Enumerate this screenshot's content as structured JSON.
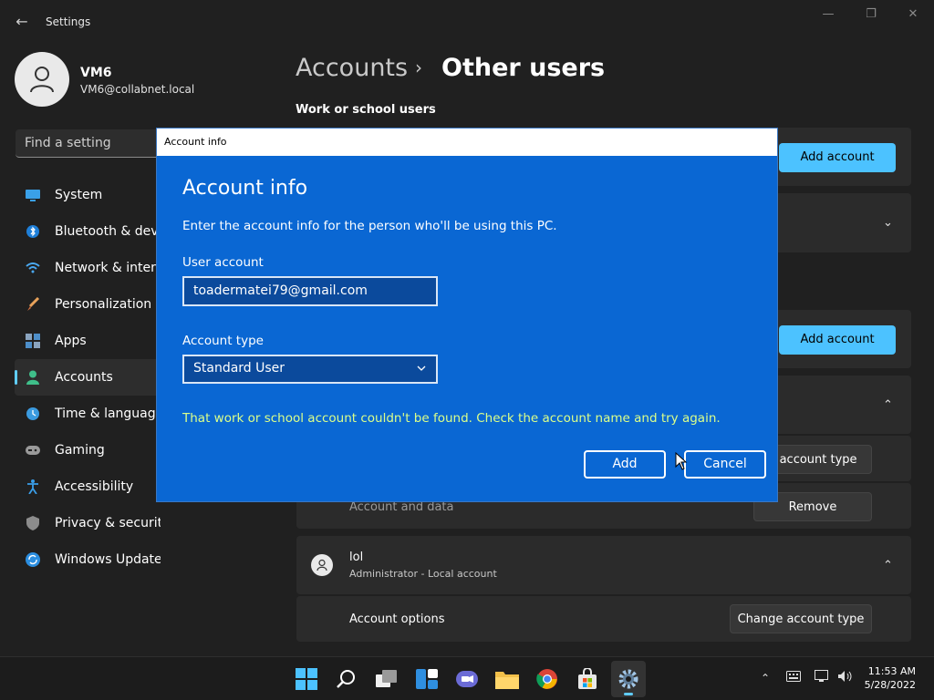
{
  "app": {
    "title": "Settings",
    "back_glyph": "←",
    "window_controls": {
      "minimize": "—",
      "maximize": "❐",
      "close": "✕"
    }
  },
  "profile": {
    "name": "VM6",
    "email": "VM6@collabnet.local"
  },
  "search": {
    "placeholder": "Find a setting"
  },
  "nav": {
    "items": [
      {
        "label": "System",
        "icon": "monitor-icon"
      },
      {
        "label": "Bluetooth & devices",
        "icon": "bluetooth-icon"
      },
      {
        "label": "Network & internet",
        "icon": "wifi-icon"
      },
      {
        "label": "Personalization",
        "icon": "brush-icon"
      },
      {
        "label": "Apps",
        "icon": "apps-icon"
      },
      {
        "label": "Accounts",
        "icon": "person-icon",
        "active": true
      },
      {
        "label": "Time & language",
        "icon": "globe-clock-icon"
      },
      {
        "label": "Gaming",
        "icon": "gamepad-icon"
      },
      {
        "label": "Accessibility",
        "icon": "accessibility-icon"
      },
      {
        "label": "Privacy & security",
        "icon": "shield-icon"
      },
      {
        "label": "Windows Update",
        "icon": "update-icon"
      }
    ]
  },
  "main": {
    "breadcrumb_parent": "Accounts",
    "breadcrumb_sep": "›",
    "breadcrumb_current": "Other users",
    "section_work": "Work or school users",
    "add_account_1": "Add account",
    "add_account_2": "Add account",
    "change_account_type_partial": "e account type",
    "account_and_data": "Account and data",
    "remove": "Remove",
    "user_lol": {
      "name": "lol",
      "subtitle": "Administrator - Local account"
    },
    "account_options": "Account options",
    "change_account_type": "Change account type"
  },
  "dialog": {
    "window_title": "Account info",
    "heading": "Account info",
    "description": "Enter the account info for the person who'll be using this PC.",
    "user_account_label": "User account",
    "user_account_value": "toadermatei79@gmail.com",
    "account_type_label": "Account type",
    "account_type_value": "Standard User",
    "error": "That work or school account couldn't be found. Check the account name and try again.",
    "add_button": "Add",
    "cancel_button": "Cancel"
  },
  "taskbar": {
    "icons": [
      "windows-start-icon",
      "search-icon",
      "task-view-icon",
      "widgets-icon",
      "chat-icon",
      "file-explorer-icon",
      "chrome-icon",
      "store-icon",
      "settings-icon"
    ],
    "time": "11:53 AM",
    "date": "5/28/2022"
  },
  "colors": {
    "accent": "#4cc2ff",
    "dialog_bg": "#0a67d3",
    "error_text": "#dbff8a"
  }
}
